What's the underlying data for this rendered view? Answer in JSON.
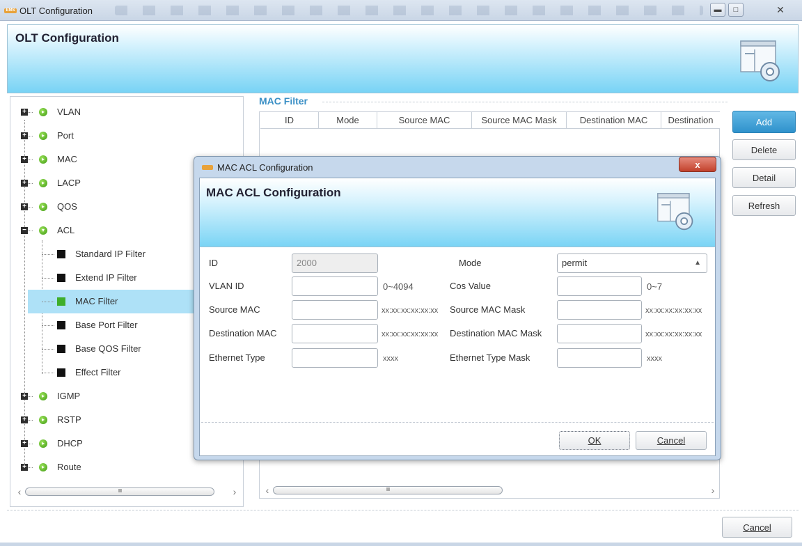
{
  "window": {
    "title": "OLT Configuration",
    "badge": "EMS"
  },
  "header": {
    "title": "OLT Configuration"
  },
  "tree": {
    "categories": [
      {
        "label": "VLAN",
        "expanded": false
      },
      {
        "label": "Port",
        "expanded": false
      },
      {
        "label": "MAC",
        "expanded": false
      },
      {
        "label": "LACP",
        "expanded": false
      },
      {
        "label": "QOS",
        "expanded": false
      },
      {
        "label": "ACL",
        "expanded": true
      },
      {
        "label": "IGMP",
        "expanded": false
      },
      {
        "label": "RSTP",
        "expanded": false
      },
      {
        "label": "DHCP",
        "expanded": false
      },
      {
        "label": "Route",
        "expanded": false
      }
    ],
    "acl_children": [
      {
        "label": "Standard IP Filter",
        "selected": false
      },
      {
        "label": "Extend IP Filter",
        "selected": false
      },
      {
        "label": "MAC Filter",
        "selected": true
      },
      {
        "label": "Base Port Filter",
        "selected": false
      },
      {
        "label": "Base QOS Filter",
        "selected": false
      },
      {
        "label": "Effect Filter",
        "selected": false
      }
    ],
    "scroll_thumb": "IIIII"
  },
  "mac_filter": {
    "section_title": "MAC Filter",
    "columns": [
      "ID",
      "Mode",
      "Source MAC",
      "Source MAC Mask",
      "Destination MAC",
      "Destination"
    ],
    "scroll_thumb": "IIIII"
  },
  "buttons": {
    "add": "Add",
    "delete": "Delete",
    "detail": "Detail",
    "refresh": "Refresh",
    "cancel": "Cancel"
  },
  "dialog": {
    "title": "MAC ACL Configuration",
    "header_title": "MAC ACL Configuration",
    "close_glyph": "x",
    "fields": {
      "id": {
        "label": "ID",
        "value": "2000"
      },
      "mode": {
        "label": "Mode",
        "value": "permit"
      },
      "vlan_id": {
        "label": "VLAN ID",
        "value": "",
        "hint": "0~4094"
      },
      "cos_value": {
        "label": "Cos Value",
        "value": "",
        "hint": "0~7"
      },
      "source_mac": {
        "label": "Source MAC",
        "value": "",
        "hint": "xx:xx:xx:xx:xx:xx"
      },
      "source_mac_mask": {
        "label": "Source MAC Mask",
        "value": "",
        "hint": "xx:xx:xx:xx:xx:xx"
      },
      "destination_mac": {
        "label": "Destination MAC",
        "value": "",
        "hint": "xx:xx:xx:xx:xx:xx"
      },
      "destination_mac_mask": {
        "label": "Destination MAC Mask",
        "value": "",
        "hint": "xx:xx:xx:xx:xx:xx"
      },
      "ethernet_type": {
        "label": "Ethernet Type",
        "value": "",
        "hint": "xxxx"
      },
      "ethernet_type_mask": {
        "label": "Ethernet Type Mask",
        "value": "",
        "hint": "xxxx"
      }
    },
    "ok": "OK",
    "cancel": "Cancel"
  }
}
